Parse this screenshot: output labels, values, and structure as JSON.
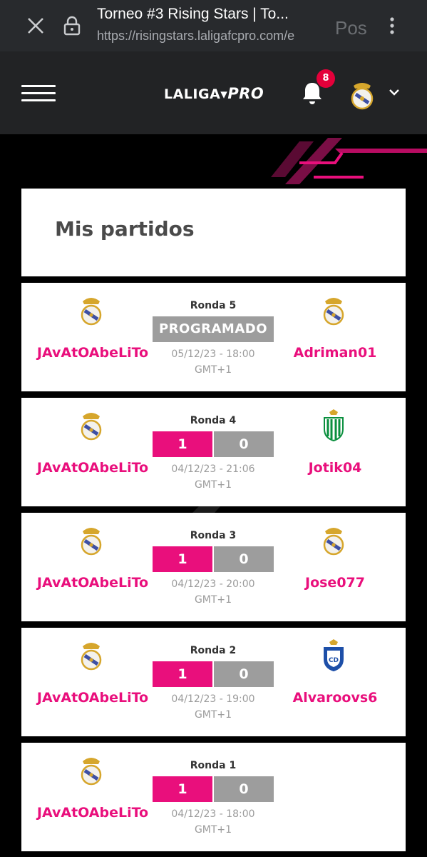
{
  "browser": {
    "title": "Torneo #3 Rising Stars | To...",
    "url": "https://risingstars.laligafcpro.com/e",
    "overflow_text": "Pos"
  },
  "header": {
    "logo_main": "LALIGA",
    "logo_pro": "PRO",
    "notification_count": "8"
  },
  "page_title": "Mis partidos",
  "matches": [
    {
      "round": "Ronda 5",
      "status": "PROGRAMADO",
      "home": "JAvAtOAbeLiTo",
      "away": "Adriman01",
      "datetime": "05/12/23 - 18:00",
      "tz": "GMT+1",
      "away_crest": "real-madrid-crest-icon"
    },
    {
      "round": "Ronda 4",
      "home_score": "1",
      "away_score": "0",
      "home": "JAvAtOAbeLiTo",
      "away": "Jotik04",
      "datetime": "04/12/23 - 21:06",
      "tz": "GMT+1",
      "away_crest": "real-betis-crest-icon"
    },
    {
      "round": "Ronda 3",
      "home_score": "1",
      "away_score": "0",
      "home": "JAvAtOAbeLiTo",
      "away": "Jose077",
      "datetime": "04/12/23 - 20:00",
      "tz": "GMT+1",
      "away_crest": "real-madrid-crest-icon"
    },
    {
      "round": "Ronda 2",
      "home_score": "1",
      "away_score": "0",
      "home": "JAvAtOAbeLiTo",
      "away": "Alvaroovs6",
      "datetime": "04/12/23 - 19:00",
      "tz": "GMT+1",
      "away_crest": "tenerife-crest-icon"
    },
    {
      "round": "Ronda 1",
      "home_score": "1",
      "away_score": "0",
      "home": "JAvAtOAbeLiTo",
      "away": "",
      "datetime": "04/12/23 - 18:00",
      "tz": "GMT+1"
    }
  ],
  "colors": {
    "accent": "#e90f7c",
    "score_grey": "#9d9d9d",
    "header_bg": "#222325"
  }
}
